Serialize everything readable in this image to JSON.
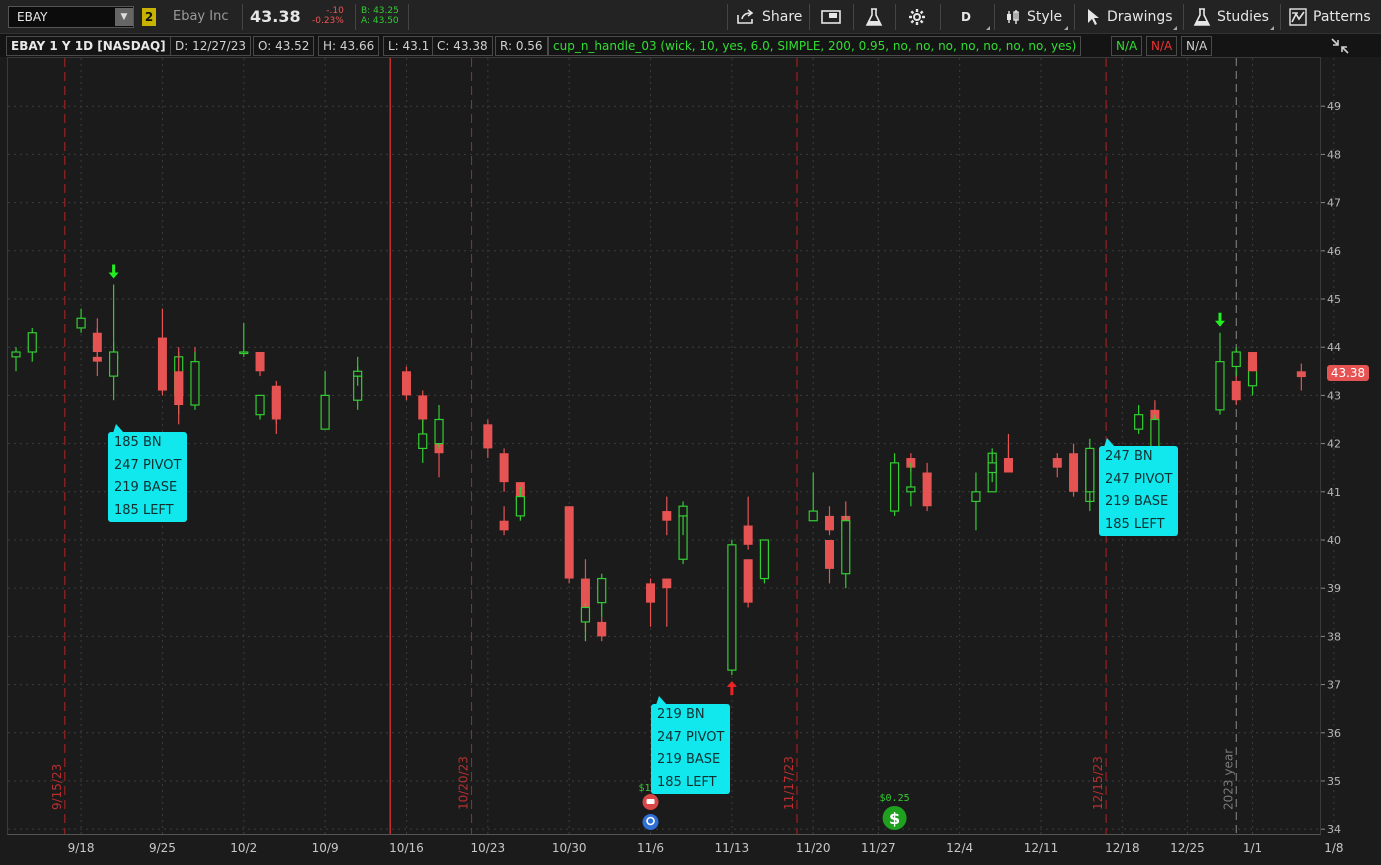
{
  "toolbar": {
    "symbol": "EBAY",
    "link_number": "2",
    "company": "Ebay Inc",
    "last": "43.38",
    "net_change": "-.10",
    "net_pct": "-0.23%",
    "bid": "B: 43.25",
    "ask": "A: 43.50",
    "share_label": "Share",
    "aggregation": "D",
    "style_label": "Style",
    "drawings_label": "Drawings",
    "studies_label": "Studies",
    "patterns_label": "Patterns"
  },
  "infobar": {
    "title": "EBAY 1 Y 1D [NASDAQ]",
    "date": "D: 12/27/23",
    "open": "O: 43.52",
    "high": "H: 43.66",
    "low": "L: 43.1",
    "close": "C: 43.38",
    "range": "R: 0.56",
    "study": "cup_n_handle_03 (wick, 10, yes, 6.0, SIMPLE, 200, 0.95, no, no, no, no, no, no, no, yes)",
    "na1": "N/A",
    "na2": "N/A",
    "na3": "N/A"
  },
  "colors": {
    "up": "#33cc33",
    "down": "#e55353",
    "label_bg": "#11e8ee",
    "background": "#1b1b1b"
  },
  "chart_data": {
    "type": "candlestick",
    "price_axis": [
      "34",
      "35",
      "36",
      "37",
      "38",
      "39",
      "40",
      "41",
      "42",
      "43",
      "44",
      "45",
      "46",
      "47",
      "48",
      "49"
    ],
    "ylim": [
      33.9,
      50.0
    ],
    "date_axis": [
      {
        "d": 4,
        "label": "9/18"
      },
      {
        "d": 9,
        "label": "9/25"
      },
      {
        "d": 14,
        "label": "10/2"
      },
      {
        "d": 19,
        "label": "10/9"
      },
      {
        "d": 24,
        "label": "10/16"
      },
      {
        "d": 29,
        "label": "10/23"
      },
      {
        "d": 34,
        "label": "10/30"
      },
      {
        "d": 39,
        "label": "11/6"
      },
      {
        "d": 44,
        "label": "11/13"
      },
      {
        "d": 49,
        "label": "11/20"
      },
      {
        "d": 53,
        "label": "11/27"
      },
      {
        "d": 58,
        "label": "12/4"
      },
      {
        "d": 63,
        "label": "12/11"
      },
      {
        "d": 68,
        "label": "12/18"
      },
      {
        "d": 72,
        "label": "12/25"
      },
      {
        "d": 76,
        "label": "1/1"
      },
      {
        "d": 81,
        "label": "1/8"
      }
    ],
    "candles": [
      [
        43.8,
        44.0,
        43.5,
        43.9
      ],
      [
        43.9,
        44.4,
        43.7,
        44.3
      ],
      [
        44.4,
        44.8,
        44.3,
        44.6
      ],
      [
        44.3,
        44.4,
        43.7,
        43.9
      ],
      [
        43.8,
        44.1,
        43.5,
        43.8
      ],
      [
        43.8,
        44.6,
        43.4,
        43.7
      ],
      [
        43.4,
        45.3,
        42.9,
        43.9
      ],
      [
        44.2,
        44.8,
        43.0,
        43.1
      ],
      [
        43.0,
        43.9,
        42.6,
        43.8
      ],
      [
        43.6,
        44.0,
        43.2,
        43.5
      ],
      [
        43.5,
        44.0,
        42.4,
        42.8
      ],
      [
        42.8,
        43.9,
        42.7,
        43.7
      ],
      [
        43.9,
        44.5,
        43.8,
        43.9
      ],
      [
        43.9,
        43.9,
        43.4,
        43.5
      ],
      [
        43.2,
        43.3,
        42.4,
        42.5
      ],
      [
        42.6,
        43.0,
        42.5,
        43.0
      ],
      [
        43.1,
        43.1,
        42.2,
        42.6
      ],
      [
        42.3,
        43.5,
        42.3,
        43.0
      ],
      [
        42.9,
        43.6,
        42.7,
        43.4
      ],
      [
        43.4,
        43.8,
        43.2,
        43.5
      ],
      [
        43.5,
        43.6,
        42.9,
        43.0
      ],
      [
        43.0,
        43.1,
        41.9,
        42.5
      ],
      [
        42.5,
        42.5,
        41.3,
        41.8
      ],
      [
        41.9,
        42.5,
        41.6,
        42.2
      ],
      [
        42.0,
        42.8,
        41.9,
        42.5
      ],
      [
        42.4,
        42.5,
        41.7,
        41.9
      ],
      [
        41.8,
        41.9,
        41.0,
        41.2
      ],
      [
        41.2,
        41.2,
        40.7,
        40.8
      ],
      [
        40.4,
        40.7,
        40.1,
        40.2
      ],
      [
        40.5,
        41.1,
        40.4,
        40.9
      ],
      [
        40.7,
        40.7,
        39.1,
        39.2
      ],
      [
        39.2,
        39.6,
        38.1,
        38.3
      ],
      [
        38.3,
        38.4,
        37.9,
        38.0
      ],
      [
        38.3,
        38.7,
        37.9,
        38.6
      ],
      [
        38.7,
        39.3,
        38.4,
        39.2
      ],
      [
        39.1,
        39.2,
        38.2,
        38.7
      ],
      [
        39.2,
        39.2,
        38.2,
        39.0
      ],
      [
        39.6,
        40.7,
        39.5,
        40.5
      ],
      [
        40.6,
        40.9,
        40.1,
        40.4
      ],
      [
        40.5,
        40.8,
        40.1,
        40.7
      ],
      [
        37.3,
        40.0,
        37.2,
        39.9
      ],
      [
        40.3,
        40.9,
        39.8,
        39.9
      ],
      [
        40.0,
        40.0,
        39.8,
        39.9
      ],
      [
        39.6,
        39.6,
        38.6,
        38.7
      ],
      [
        39.2,
        40.0,
        39.1,
        40.0
      ],
      [
        40.4,
        41.4,
        40.4,
        40.6
      ],
      [
        40.5,
        40.7,
        40.1,
        40.2
      ],
      [
        40.5,
        40.8,
        39.8,
        40.2
      ],
      [
        40.0,
        40.0,
        39.1,
        39.4
      ],
      [
        39.3,
        40.5,
        39.0,
        40.4
      ],
      [
        40.6,
        41.8,
        40.5,
        41.6
      ],
      [
        41.7,
        41.8,
        41.4,
        41.5
      ],
      [
        41.4,
        41.6,
        41.0,
        41.3
      ],
      [
        41.0,
        41.6,
        40.7,
        41.1
      ],
      [
        41.4,
        41.4,
        40.6,
        40.7
      ],
      [
        40.8,
        41.4,
        40.2,
        41.0
      ],
      [
        41.0,
        41.9,
        41.0,
        41.8
      ],
      [
        41.7,
        42.0,
        41.4,
        41.6
      ],
      [
        41.4,
        41.8,
        41.2,
        41.6
      ],
      [
        41.7,
        42.2,
        41.4,
        41.4
      ],
      [
        41.7,
        41.8,
        41.3,
        41.5
      ],
      [
        41.4,
        41.6,
        41.0,
        41.2
      ],
      [
        40.8,
        42.1,
        40.6,
        41.8
      ],
      [
        41.8,
        42.0,
        40.9,
        41.0
      ],
      [
        41.0,
        41.9,
        40.8,
        41.9
      ],
      [
        42.3,
        42.8,
        42.2,
        42.6
      ],
      [
        42.7,
        42.9,
        42.0,
        41.9
      ],
      [
        41.6,
        42.6,
        41.5,
        42.5
      ],
      [
        42.7,
        44.3,
        42.6,
        43.7
      ],
      [
        43.3,
        43.5,
        42.8,
        42.9
      ],
      [
        43.2,
        43.8,
        43.0,
        43.7
      ],
      [
        43.6,
        44.0,
        43.4,
        43.9
      ],
      [
        43.9,
        43.9,
        43.5,
        43.5
      ],
      [
        43.5,
        43.66,
        43.1,
        43.38
      ]
    ],
    "candle_dates": "daily bars from 9/14/23 to 12/27/23",
    "month_markers": [
      {
        "d": 3,
        "label": "9/15/23"
      },
      {
        "d": 28,
        "label": "10/20/23"
      },
      {
        "d": 48,
        "label": "11/17/23"
      },
      {
        "d": 67,
        "label": "12/15/23"
      }
    ],
    "year_marker": {
      "d": 75,
      "label": "2023 year"
    },
    "red_vline_d": 23,
    "dividends": [
      {
        "d": 39,
        "label": "$1.0"
      },
      {
        "d": 54,
        "label": "$0.25"
      }
    ],
    "arrows": [
      {
        "i": 6,
        "dir": "down",
        "color": "#22ee22",
        "price": 45.3
      },
      {
        "i": 40,
        "dir": "up",
        "color": "#ee2222",
        "price": 37.2
      },
      {
        "i": 68,
        "dir": "down",
        "color": "#22ee22",
        "price": 44.3
      }
    ]
  },
  "labels": [
    {
      "lines": [
        "185  BN",
        "247  PIVOT",
        "219  BASE",
        "185  LEFT"
      ]
    },
    {
      "lines": [
        "219  BN",
        "247  PIVOT",
        "219  BASE",
        "185  LEFT"
      ]
    },
    {
      "lines": [
        "247  BN",
        "247  PIVOT",
        "219  BASE",
        "185  LEFT"
      ]
    }
  ]
}
